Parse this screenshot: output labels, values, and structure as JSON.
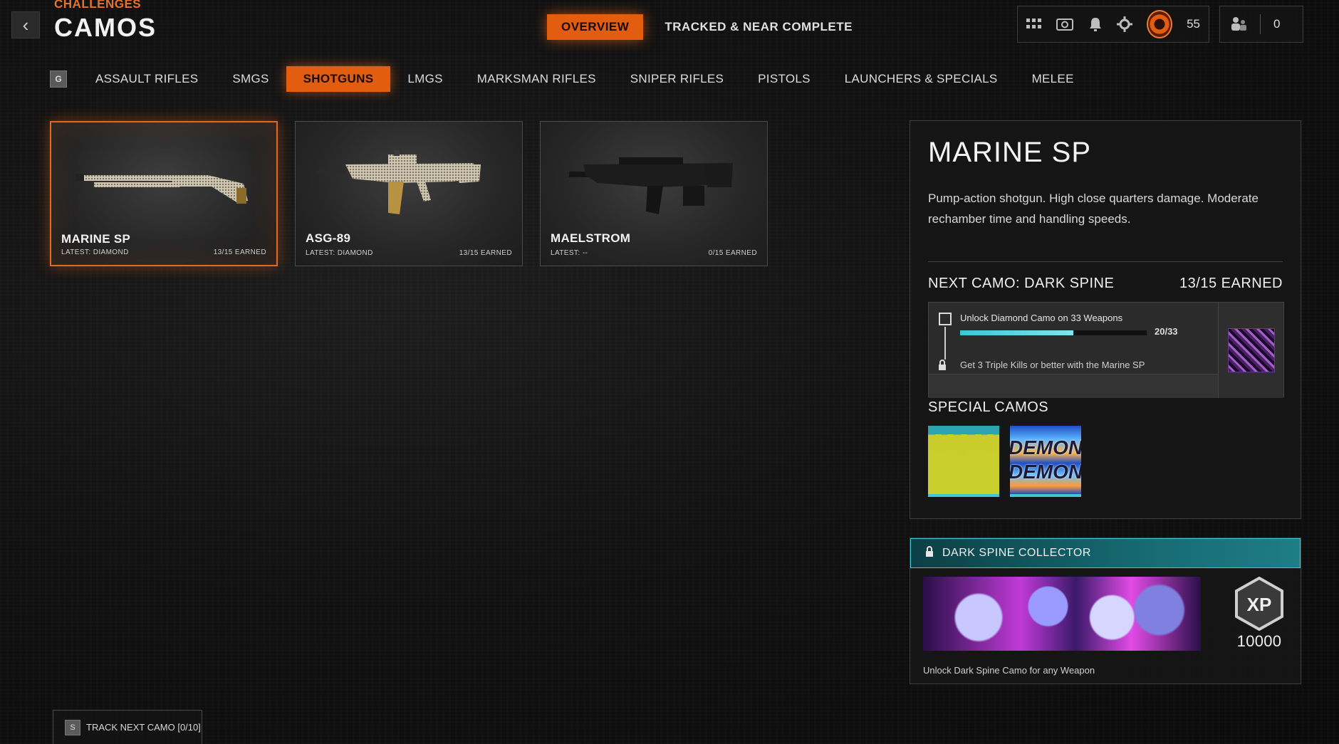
{
  "header": {
    "breadcrumb": "CHALLENGES",
    "title": "CAMOS",
    "back_glyph": "‹",
    "tabs": [
      {
        "label": "OVERVIEW",
        "active": true
      },
      {
        "label": "TRACKED & NEAR COMPLETE",
        "active": false
      }
    ]
  },
  "hud": {
    "icons": [
      "grid-icon",
      "camera-icon",
      "bell-icon",
      "gear-icon"
    ],
    "level": "55",
    "party_count": "0"
  },
  "categories": {
    "key_hint": "G",
    "tabs": [
      {
        "label": "ASSAULT RIFLES",
        "active": false
      },
      {
        "label": "SMGS",
        "active": false
      },
      {
        "label": "SHOTGUNS",
        "active": true
      },
      {
        "label": "LMGS",
        "active": false
      },
      {
        "label": "MARKSMAN RIFLES",
        "active": false
      },
      {
        "label": "SNIPER RIFLES",
        "active": false
      },
      {
        "label": "PISTOLS",
        "active": false
      },
      {
        "label": "LAUNCHERS & SPECIALS",
        "active": false
      },
      {
        "label": "MELEE",
        "active": false
      }
    ]
  },
  "weapons": [
    {
      "name": "MARINE SP",
      "latest": "LATEST: DIAMOND",
      "earned": "13/15 EARNED",
      "selected": true
    },
    {
      "name": "ASG-89",
      "latest": "LATEST: DIAMOND",
      "earned": "13/15 EARNED",
      "selected": false
    },
    {
      "name": "MAELSTROM",
      "latest": "LATEST: --",
      "earned": "0/15 EARNED",
      "selected": false
    }
  ],
  "detail": {
    "title": "MARINE SP",
    "description": "Pump-action shotgun.  High close quarters damage. Moderate rechamber time and handling speeds.",
    "next_camo_label": "NEXT CAMO: DARK SPINE",
    "next_camo_earned": "13/15 EARNED",
    "challenge_1": "Unlock Diamond Camo on 33 Weapons",
    "challenge_1_progress": "20/33",
    "challenge_1_fraction": 0.606,
    "challenge_2": "Get 3 Triple Kills or better with the Marine SP",
    "special_label": "SPECIAL CAMOS",
    "demon_text": [
      "DEMON",
      "DEMON"
    ]
  },
  "collector": {
    "title": "DARK SPINE COLLECTOR",
    "xp_label": "XP",
    "xp_amount": "10000",
    "description": "Unlock Dark Spine Camo for any Weapon"
  },
  "footer": {
    "key_hint": "S",
    "track_label": "TRACK NEXT CAMO [0/10]"
  },
  "colors": {
    "accent_orange": "#e35d10",
    "accent_teal": "#3fc6d1"
  }
}
